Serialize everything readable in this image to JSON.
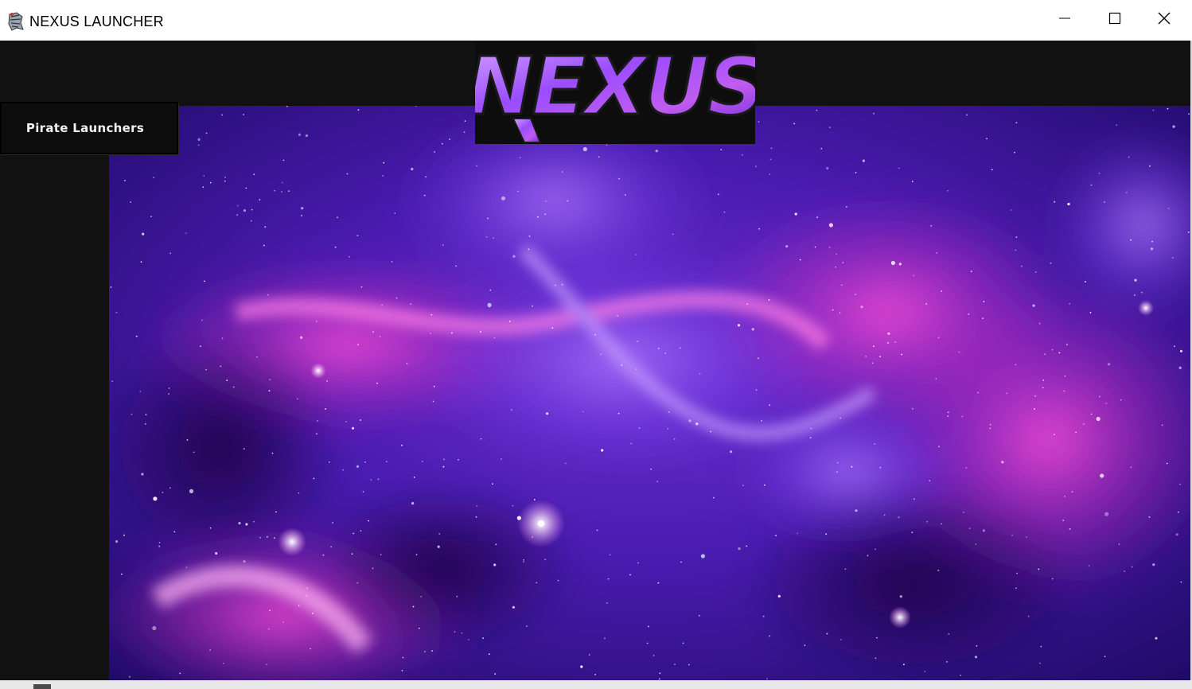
{
  "window": {
    "title": "NEXUS LAUNCHER",
    "controls": [
      "minimize-icon",
      "maximize-icon",
      "close-icon"
    ]
  },
  "logo": {
    "text": "NEXUS"
  },
  "sidebar": {
    "items": [
      {
        "label": "Pirate Launchers",
        "icon": ""
      }
    ]
  },
  "main": {
    "background": "galaxy-nebula-image"
  },
  "colors": {
    "frame": "#111111",
    "titlebar": "#ffffff",
    "accent_purple": "#7b3fe0",
    "accent_magenta": "#e03cc8",
    "button_text": "#f2f2f2"
  }
}
